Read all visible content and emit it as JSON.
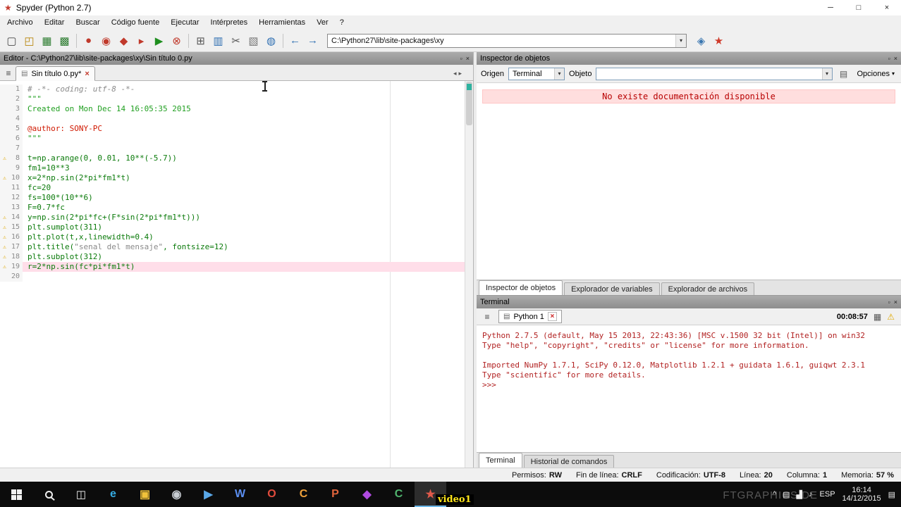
{
  "window": {
    "title": "Spyder (Python 2.7)",
    "logo_glyph": "★",
    "controls": {
      "minimize": "─",
      "maximize": "□",
      "close": "×"
    }
  },
  "menu": {
    "items": [
      "Archivo",
      "Editar",
      "Buscar",
      "Código fuente",
      "Ejecutar",
      "Intérpretes",
      "Herramientas",
      "Ver",
      "?"
    ]
  },
  "toolbar": {
    "left_icons": [
      {
        "name": "new-file-icon",
        "glyph": "▢",
        "color": "#4a4a4a"
      },
      {
        "name": "open-file-icon",
        "glyph": "◰",
        "color": "#b8860b"
      },
      {
        "name": "save-icon",
        "glyph": "▦",
        "color": "#2e7d32"
      },
      {
        "name": "save-all-icon",
        "glyph": "▩",
        "color": "#2e7d32"
      },
      {
        "name": "sep",
        "cls": "sep"
      },
      {
        "name": "debug-file-icon",
        "glyph": "●",
        "color": "#c0392b"
      },
      {
        "name": "debug-cell-icon",
        "glyph": "◉",
        "color": "#c0392b"
      },
      {
        "name": "run-selection-icon",
        "glyph": "◆",
        "color": "#c0392b"
      },
      {
        "name": "continue-icon",
        "glyph": "▸",
        "color": "#c0392b"
      },
      {
        "name": "run-icon",
        "glyph": "▶",
        "color": "#1e8e1e"
      },
      {
        "name": "stop-icon",
        "glyph": "⊗",
        "color": "#c0392b"
      },
      {
        "name": "sep",
        "cls": "sep"
      },
      {
        "name": "console-icon",
        "glyph": "⊞",
        "color": "#555555"
      },
      {
        "name": "plot-icon",
        "glyph": "▥",
        "color": "#2f6fb2"
      },
      {
        "name": "cut-icon",
        "glyph": "✂",
        "color": "#555555"
      },
      {
        "name": "layers-icon",
        "glyph": "▧",
        "color": "#777777"
      },
      {
        "name": "web-icon",
        "glyph": "◍",
        "color": "#2f6fb2"
      },
      {
        "name": "sep",
        "cls": "sep"
      },
      {
        "name": "back-icon",
        "glyph": "←",
        "color": "#2f6fb2"
      },
      {
        "name": "forward-icon",
        "glyph": "→",
        "color": "#2f6fb2"
      }
    ],
    "path": "C:\\Python27\\lib\\site-packages\\xy",
    "dropdown_glyph": "▾",
    "right_icons": [
      {
        "name": "python-logo-icon",
        "glyph": "◈",
        "color": "#3a76b0"
      },
      {
        "name": "spyder-icon",
        "glyph": "★",
        "color": "#cf3a2a"
      }
    ]
  },
  "editor": {
    "pane_title": "Editor - C:\\Python27\\lib\\site-packages\\xy\\Sin título 0.py",
    "undock_glyph": "▫",
    "close_glyph": "×",
    "browse_tabs_glyph": "≡",
    "tab": {
      "icon_glyph": "▤",
      "label": "Sin título 0.py*",
      "close_glyph": "×"
    },
    "tab_scroll_left_glyph": "◂",
    "tab_scroll_right_glyph": "▸",
    "lines": [
      {
        "n": "1",
        "a": "# -*- coding: utf-8 -*-",
        "ca": "t-comment"
      },
      {
        "n": "2",
        "a": "\"\"\"",
        "ca": "t-string"
      },
      {
        "n": "3",
        "a": "Created on Mon Dec 14 16:05:35 2015",
        "ca": "t-string"
      },
      {
        "n": "4",
        "a": ""
      },
      {
        "n": "5",
        "a": "@author: SONY-PC",
        "ca": "t-author"
      },
      {
        "n": "6",
        "a": "\"\"\"",
        "ca": "t-string"
      },
      {
        "n": "7",
        "a": ""
      },
      {
        "n": "8",
        "w": "warn",
        "a": "t=np.arange(0, 0.01, 10**(-5.7))",
        "ca": "t-code"
      },
      {
        "n": "9",
        "a": "fm1=10**3",
        "ca": "t-code"
      },
      {
        "n": "10",
        "w": "warn",
        "a": "x=2*np.sin(2*pi*fm1*t)",
        "ca": "t-code"
      },
      {
        "n": "11",
        "a": "fc=20",
        "ca": "t-code"
      },
      {
        "n": "12",
        "a": "fs=100*(10**6)",
        "ca": "t-code"
      },
      {
        "n": "13",
        "a": "F=0.7*fc",
        "ca": "t-code"
      },
      {
        "n": "14",
        "w": "warn",
        "a": "y=np.sin(2*pi*fc+(F*sin(2*pi*fm1*t)))",
        "ca": "t-code"
      },
      {
        "n": "15",
        "w": "warn",
        "a": "plt.sumplot(311)",
        "ca": "t-code"
      },
      {
        "n": "16",
        "w": "warn",
        "a": "plt.plot(t,x,linewidth=0.4)",
        "ca": "t-code"
      },
      {
        "n": "17",
        "w": "warn",
        "a": "plt.title(",
        "ca": "t-code",
        "b": "\"senal del mensaje\"",
        "cb": "t-str2",
        "c": ", fontsize=12)",
        "cc": "t-code"
      },
      {
        "n": "18",
        "w": "warn",
        "a": "plt.subplot(312)",
        "ca": "t-code"
      },
      {
        "n": "19",
        "w": "warn",
        "row": "cur",
        "a": "r=2*np.sin(fc*pi*fm1*t)",
        "ca": "t-code"
      },
      {
        "n": "20",
        "a": ""
      }
    ]
  },
  "inspector": {
    "title": "Inspector de objetos",
    "undock_glyph": "▫",
    "close_glyph": "×",
    "origin_label": "Origen",
    "origin_value": "Terminal",
    "object_label": "Objeto",
    "object_value": "",
    "caret_glyph": "▾",
    "doc_icon_glyph": "▤",
    "options_label": "Opciones",
    "message": "No existe documentación disponible",
    "tabs": [
      {
        "label": "Inspector de objetos",
        "cls": "active"
      },
      {
        "label": "Explorador de variables",
        "cls": ""
      },
      {
        "label": "Explorador de archivos",
        "cls": ""
      }
    ]
  },
  "terminal": {
    "title": "Terminal",
    "undock_glyph": "▫",
    "close_glyph": "×",
    "console_icon_glyph": "≡",
    "tab_icon_glyph": "▤",
    "tab_label": "Python 1",
    "tab_close_glyph": "×",
    "time": "00:08:57",
    "interrupt_glyph": "▦",
    "warning_glyph": "⚠",
    "lines": [
      "Python 2.7.5 (default, May 15 2013, 22:43:36) [MSC v.1500 32 bit (Intel)] on win32",
      "Type \"help\", \"copyright\", \"credits\" or \"license\" for more information.",
      "",
      "Imported NumPy 1.7.1, SciPy 0.12.0, Matplotlib 1.2.1 + guidata 1.6.1, guiqwt 2.3.1",
      "Type \"scientific\" for more details.",
      ">>>"
    ],
    "tabs": [
      {
        "label": "Terminal",
        "cls": "active"
      },
      {
        "label": "Historial de comandos",
        "cls": ""
      }
    ]
  },
  "statusbar": {
    "items": [
      {
        "label": "Permisos:",
        "value": "RW"
      },
      {
        "label": "Fin de línea:",
        "value": "CRLF"
      },
      {
        "label": "Codificación:",
        "value": "UTF-8"
      },
      {
        "label": "Línea:",
        "value": "20"
      },
      {
        "label": "Columna:",
        "value": "1"
      },
      {
        "label": "Memoria:",
        "value": "57 %"
      }
    ]
  },
  "taskbar": {
    "taskview_glyph": "◫",
    "apps": [
      {
        "name": "taskbar-edge-icon",
        "glyph": "e",
        "color": "#35abe2",
        "cls": ""
      },
      {
        "name": "taskbar-explorer-icon",
        "glyph": "▣",
        "color": "#f0c23a",
        "cls": ""
      },
      {
        "name": "taskbar-dvd-icon",
        "glyph": "◉",
        "color": "#c9ced4",
        "cls": ""
      },
      {
        "name": "taskbar-media-icon",
        "glyph": "▶",
        "color": "#5aa8e8",
        "cls": ""
      },
      {
        "name": "taskbar-word-icon",
        "glyph": "W",
        "color": "#5b8ef0",
        "cls": ""
      },
      {
        "name": "taskbar-opera-icon",
        "glyph": "O",
        "color": "#e04b3c",
        "cls": ""
      },
      {
        "name": "taskbar-app-icon",
        "glyph": "C",
        "color": "#f0a13a",
        "cls": ""
      },
      {
        "name": "taskbar-powerpoint-icon",
        "glyph": "P",
        "color": "#e0643c",
        "cls": ""
      },
      {
        "name": "taskbar-app-icon",
        "glyph": "◆",
        "color": "#b04be0",
        "cls": ""
      },
      {
        "name": "taskbar-app-icon",
        "glyph": "C",
        "color": "#50b46e",
        "cls": ""
      },
      {
        "name": "taskbar-spyder-icon",
        "glyph": "★",
        "color": "#e05a4b",
        "cls": "active"
      }
    ],
    "recording_label": "video1",
    "tray": {
      "icons": [
        {
          "name": "tray-expand-icon",
          "glyph": "^"
        },
        {
          "name": "tray-keyboard-icon",
          "glyph": "▤"
        },
        {
          "name": "tray-network-icon",
          "glyph": "▟"
        },
        {
          "name": "tray-volume-icon",
          "glyph": "♪"
        }
      ],
      "language": "ESP",
      "time": "16:14",
      "date": "14/12/2015",
      "action_center_glyph": "▤"
    }
  },
  "watermark": "FTGRAPHICS.DE"
}
